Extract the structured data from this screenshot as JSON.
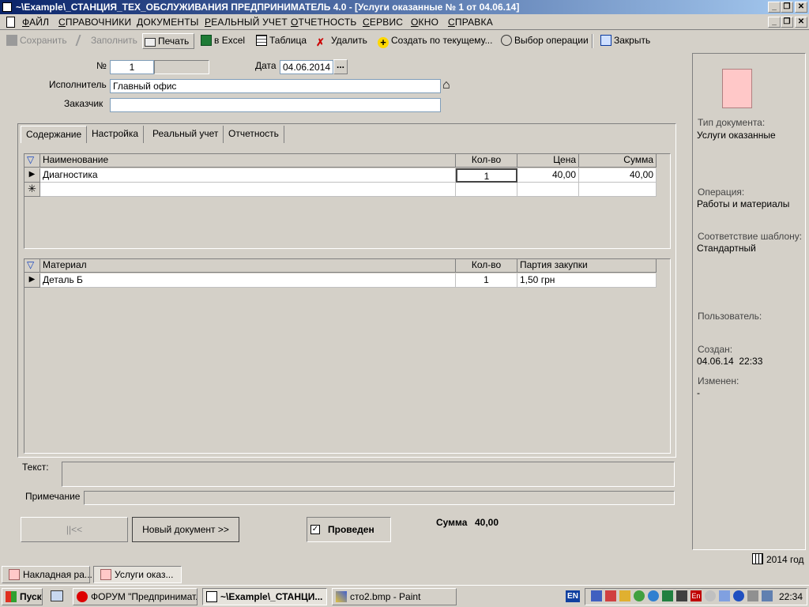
{
  "window": {
    "title": "~\\Example\\_СТАНЦИЯ_ТЕХ_ОБСЛУЖИВАНИЯ  ПРЕДПРИНИМАТЕЛЬ 4.0 - [Услуги оказанные № 1 от 04.06.14]"
  },
  "menu": {
    "items": [
      "ФАЙЛ",
      "СПРАВОЧНИКИ",
      "ДОКУМЕНТЫ",
      "РЕАЛЬНЫЙ УЧЕТ",
      "ОТЧЕТНОСТЬ",
      "СЕРВИС",
      "ОКНО",
      "СПРАВКА"
    ]
  },
  "toolbar": {
    "save": "Сохранить",
    "fill": "Заполнить",
    "print": "Печать",
    "excel": "в Excel",
    "table": "Таблица",
    "delete": "Удалить",
    "create_from": "Создать по текущему...",
    "choose_op": "Выбор операции",
    "close": "Закрыть"
  },
  "form": {
    "number_label": "№",
    "number_value": "1",
    "date_label": "Дата",
    "date_value": "04.06.2014",
    "date_btn": "...",
    "executor_label": "Исполнитель",
    "executor_value": "Главный офис",
    "customer_label": "Заказчик",
    "customer_value": ""
  },
  "tabs": [
    "Содержание",
    "Настройка",
    "Реальный учет",
    "Отчетность"
  ],
  "services_grid": {
    "headers": [
      "Наименование",
      "Кол-во",
      "Цена",
      "Сумма"
    ],
    "rows": [
      [
        "Диагностика",
        "1",
        "40,00",
        "40,00"
      ]
    ]
  },
  "materials_grid": {
    "headers": [
      "Материал",
      "Кол-во",
      "Партия закупки"
    ],
    "rows": [
      [
        "Деталь Б",
        "1",
        "1,50 грн"
      ]
    ]
  },
  "bottom": {
    "text_label": "Текст:",
    "note_label": "Примечание",
    "first_btn": "||<<",
    "new_doc_btn": "Новый документ >>",
    "posted_label": "Проведен",
    "sum_label": "Сумма",
    "sum_value": "40,00"
  },
  "side_panel": {
    "doc_type_label": "Тип документа:",
    "doc_type_value": "Услуги оказанные",
    "operation_label": "Операция:",
    "operation_value": "Работы и материалы",
    "template_label": "Соответствие шаблону:",
    "template_value": "Стандартный",
    "user_label": "Пользователь:",
    "created_label": "Создан:",
    "created_value": "04.06.14  22:33",
    "changed_label": "Изменен:",
    "changed_value": "-"
  },
  "status": {
    "year": "2014 год"
  },
  "mdi_tabs": [
    "Накладная ра...",
    "Услуги оказ..."
  ],
  "taskbar": {
    "start": "Пуск",
    "tasks": [
      "ФОРУМ \"Предпринимат...",
      "~\\Example\\_СТАНЦИ...",
      "сто2.bmp - Paint"
    ],
    "lang": "EN",
    "time": "22:34"
  }
}
